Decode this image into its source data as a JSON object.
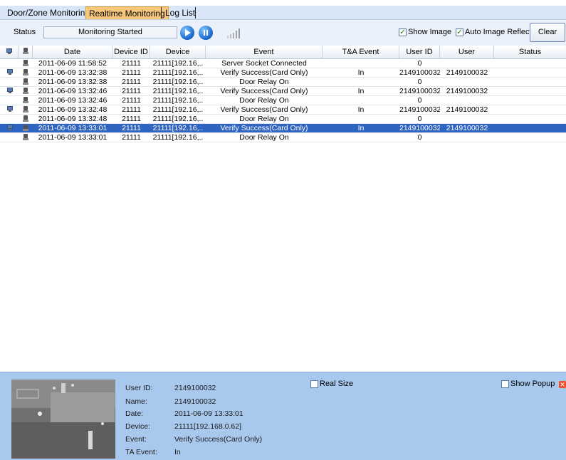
{
  "tabs": [
    {
      "label": "Door/Zone Monitoring",
      "active": false
    },
    {
      "label": "Realtime Monitoring",
      "active": true
    },
    {
      "label": "Log List",
      "active": false
    }
  ],
  "toolbar": {
    "status_label": "Status",
    "status_value": "Monitoring Started",
    "show_image_label": "Show Image",
    "show_image_checked": true,
    "auto_image_label": "Auto Image Reflect",
    "auto_image_checked": true,
    "clear_label": "Clear",
    "icons": [
      "play-icon",
      "pause-icon",
      "signal-bars-icon"
    ]
  },
  "grid": {
    "columns": [
      "",
      "",
      "Date",
      "Device ID",
      "Device",
      "Event",
      "T&A Event",
      "User ID",
      "User",
      "Status"
    ],
    "rows": [
      {
        "date": "2011-06-09 11:58:52",
        "device_id": "21111",
        "device": "21111[192.16,..",
        "event": "Server Socket Connected",
        "ta": "",
        "user_id": "0",
        "user": "",
        "status": "",
        "monitor_icon": false,
        "selected": false
      },
      {
        "date": "2011-06-09 13:32:38",
        "device_id": "21111",
        "device": "21111[192.16,..",
        "event": "Verify Success(Card Only)",
        "ta": "In",
        "user_id": "2149100032",
        "user": "2149100032",
        "status": "",
        "monitor_icon": true,
        "selected": false
      },
      {
        "date": "2011-06-09 13:32:38",
        "device_id": "21111",
        "device": "21111[192.16,..",
        "event": "Door Relay On",
        "ta": "",
        "user_id": "0",
        "user": "",
        "status": "",
        "monitor_icon": false,
        "selected": false
      },
      {
        "date": "2011-06-09 13:32:46",
        "device_id": "21111",
        "device": "21111[192.16,..",
        "event": "Verify Success(Card Only)",
        "ta": "In",
        "user_id": "2149100032",
        "user": "2149100032",
        "status": "",
        "monitor_icon": true,
        "selected": false
      },
      {
        "date": "2011-06-09 13:32:46",
        "device_id": "21111",
        "device": "21111[192.16,..",
        "event": "Door Relay On",
        "ta": "",
        "user_id": "0",
        "user": "",
        "status": "",
        "monitor_icon": false,
        "selected": false
      },
      {
        "date": "2011-06-09 13:32:48",
        "device_id": "21111",
        "device": "21111[192.16,..",
        "event": "Verify Success(Card Only)",
        "ta": "In",
        "user_id": "2149100032",
        "user": "2149100032",
        "status": "",
        "monitor_icon": true,
        "selected": false
      },
      {
        "date": "2011-06-09 13:32:48",
        "device_id": "21111",
        "device": "21111[192.16,..",
        "event": "Door Relay On",
        "ta": "",
        "user_id": "0",
        "user": "",
        "status": "",
        "monitor_icon": false,
        "selected": false
      },
      {
        "date": "2011-06-09 13:33:01",
        "device_id": "21111",
        "device": "21111[192.16,..",
        "event": "Verify Success(Card Only)",
        "ta": "In",
        "user_id": "2149100032",
        "user": "2149100032",
        "status": "",
        "monitor_icon": true,
        "selected": true
      },
      {
        "date": "2011-06-09 13:33:01",
        "device_id": "21111",
        "device": "21111[192.16,..",
        "event": "Door Relay On",
        "ta": "",
        "user_id": "0",
        "user": "",
        "status": "",
        "monitor_icon": false,
        "selected": false
      }
    ]
  },
  "detail": {
    "real_size_label": "Real Size",
    "show_popup_label": "Show Popup",
    "fields": [
      {
        "label": "User ID:",
        "value": "2149100032"
      },
      {
        "label": "Name:",
        "value": "2149100032"
      },
      {
        "label": "Date:",
        "value": "2011-06-09 13:33:01"
      },
      {
        "label": "Device:",
        "value": "21111[192.168.0.62]"
      },
      {
        "label": "Event:",
        "value": "Verify Success(Card Only)"
      },
      {
        "label": "TA Event:",
        "value": "In"
      }
    ]
  },
  "colors": {
    "selected_row": "#3064c1",
    "bottom_panel": "#a9c8ee",
    "active_tab": "#f7c77c"
  }
}
